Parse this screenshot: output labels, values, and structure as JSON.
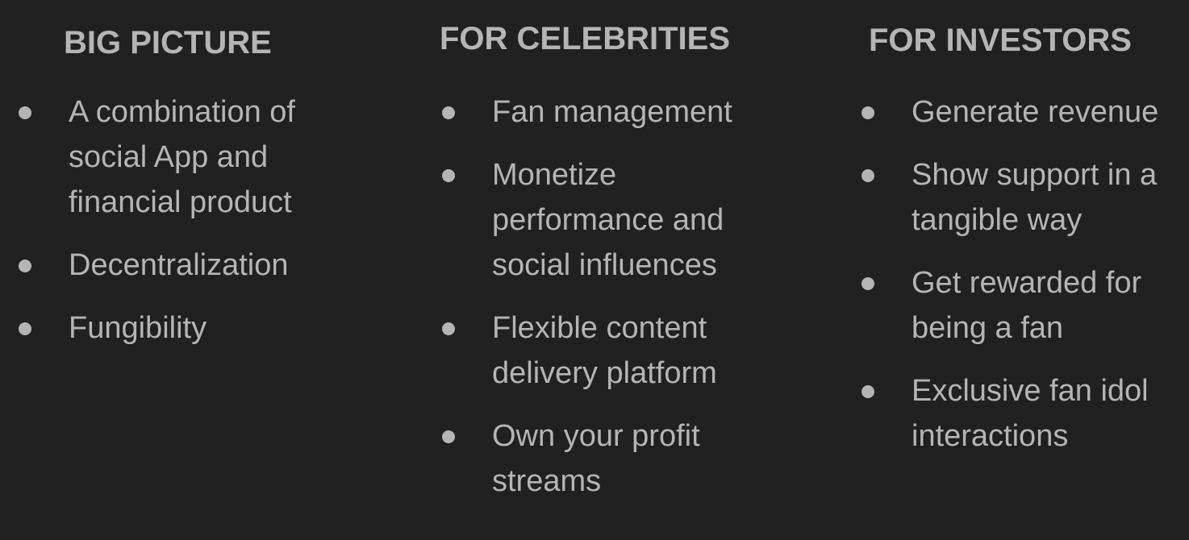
{
  "columns": [
    {
      "heading": "BIG PICTURE",
      "items": [
        "A combination of social App and financial product",
        "Decentralization",
        "Fungibility"
      ]
    },
    {
      "heading": "FOR CELEBRITIES",
      "items": [
        "Fan management",
        "Monetize performance and social influences",
        "Flexible content delivery platform",
        "Own your profit streams"
      ]
    },
    {
      "heading": "FOR INVESTORS",
      "items": [
        "Generate revenue",
        "Show support in a tangible way",
        "Get rewarded for being a fan",
        "Exclusive fan idol interactions"
      ]
    }
  ],
  "colors": {
    "background": "#212121",
    "text": "#b5b5b5"
  }
}
